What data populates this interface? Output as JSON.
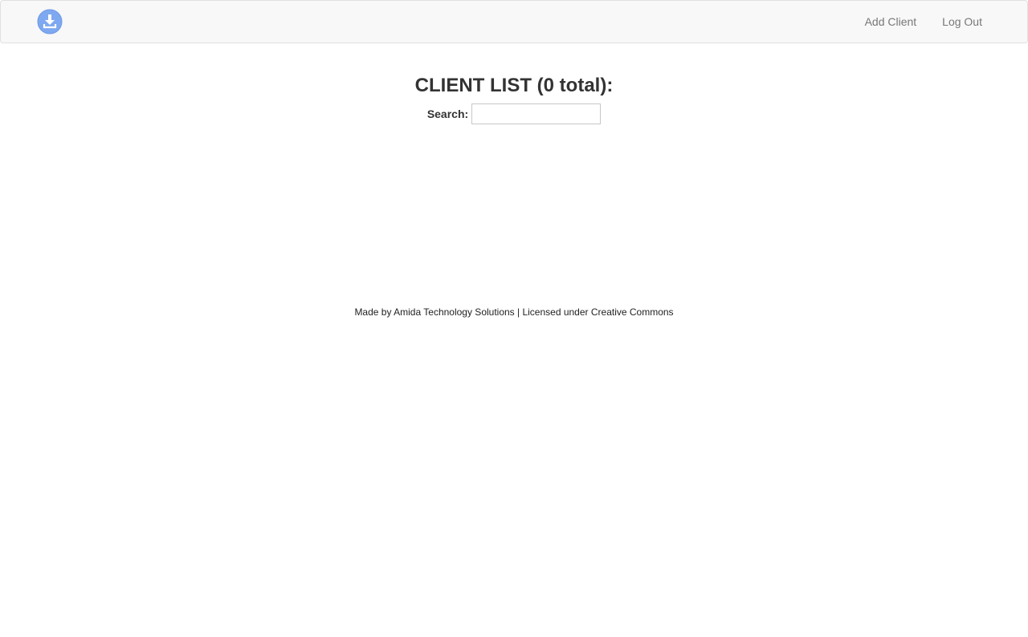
{
  "nav": {
    "logo_icon": "download-circle-icon",
    "logo_color": "#7ea8f0",
    "links": [
      {
        "label": "Add Client"
      },
      {
        "label": "Log Out"
      }
    ]
  },
  "main": {
    "title": "CLIENT LIST (0 total):",
    "search": {
      "label": "Search:",
      "value": "",
      "placeholder": ""
    }
  },
  "footer": {
    "text": "Made by Amida Technology Solutions | Licensed under Creative Commons"
  }
}
